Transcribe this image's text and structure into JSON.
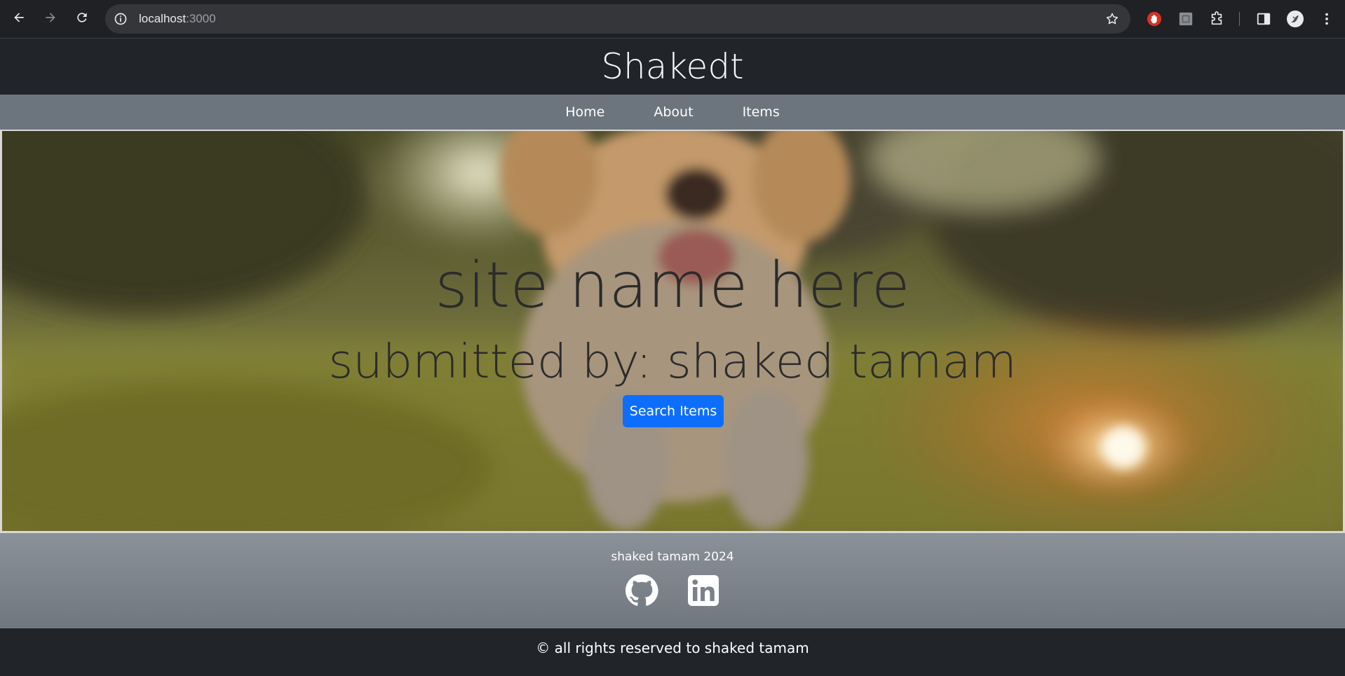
{
  "browser": {
    "url_host": "localhost",
    "url_port": ":3000",
    "icons": [
      "back-icon",
      "forward-icon",
      "reload-icon",
      "info-icon",
      "bookmark-star-icon",
      "extension-stop-icon",
      "extension-square-icon",
      "extensions-puzzle-icon",
      "side-panel-icon",
      "profile-avatar-icon",
      "menu-kebab-icon"
    ]
  },
  "header": {
    "title": "Shakedt"
  },
  "nav": {
    "items": [
      "Home",
      "About",
      "Items"
    ]
  },
  "hero": {
    "title": "site name here",
    "subtitle": "submitted by: shaked tamam",
    "button_label": "Search Items"
  },
  "footer": {
    "text": "shaked tamam 2024",
    "icons": [
      "github-icon",
      "linkedin-icon"
    ],
    "copyright": "© all rights reserved to shaked tamam"
  },
  "colors": {
    "header_bg": "#212529",
    "nav_bg": "#6c757d",
    "button": "#0d6efd"
  }
}
